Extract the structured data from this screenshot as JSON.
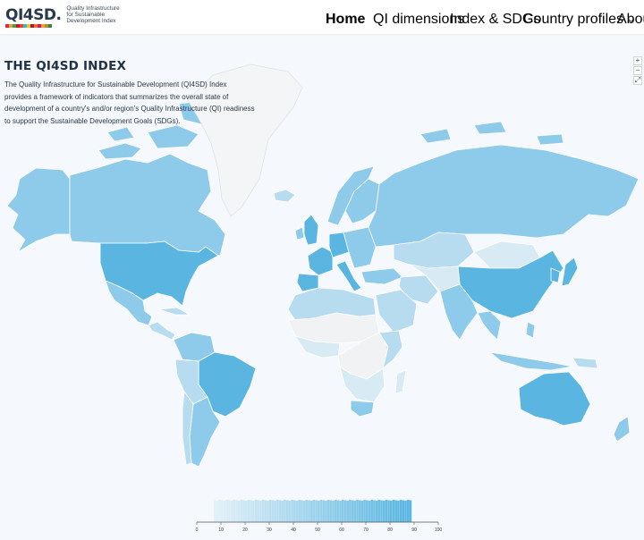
{
  "brand": {
    "mark": "QI4SD.",
    "subtitle": "Quality Infrastructure for Sustainable Development Index",
    "bar_colors": [
      "#e5243b",
      "#dda63a",
      "#4c9f38",
      "#c5192d",
      "#ff3a21",
      "#26bde2",
      "#fcc30b",
      "#a21942",
      "#fd6925",
      "#dd1367",
      "#fd9d24",
      "#bf8b2e",
      "#3f7e44"
    ]
  },
  "nav": {
    "home": "Home",
    "dimensions": "QI dimensions",
    "sdgs": "Index & SDGs",
    "profiles": "Country profiles",
    "about": "About"
  },
  "intro": {
    "title": "THE QI4SD INDEX",
    "text": "The Quality Infrastructure for Sustainable Development (QI4SD) Index provides a framework of indicators that summarizes the overall state of development of a country's and/or region's Quality Infrastructure (QI) readiness to support the Sustainable Development Goals (SDGs)."
  },
  "zoom": {
    "in": "+",
    "out": "−",
    "fit": "⤢"
  },
  "legend": {
    "ticks": [
      "0",
      "10",
      "20",
      "30",
      "40",
      "50",
      "60",
      "70",
      "80",
      "90",
      "100"
    ],
    "color_low": "#e3f0f8",
    "color_high": "#5ab6e1"
  },
  "colors": {
    "ocean": "#f5f8fc",
    "no_data": "#f0f2f4",
    "scale_1": "#d8eaf4",
    "scale_2": "#b7dbef",
    "scale_3": "#8ecbea",
    "scale_4": "#5ab6e1",
    "border": "#ffffff",
    "greenland": "#f4f5f6"
  }
}
